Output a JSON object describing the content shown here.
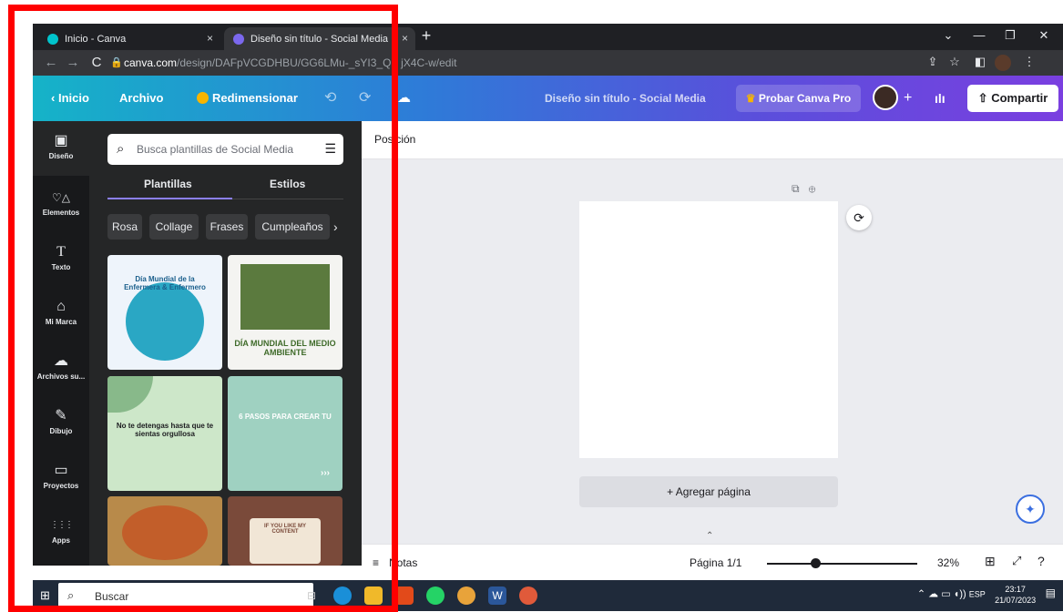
{
  "browser": {
    "tabs": [
      {
        "title": "Inicio - Canva",
        "close": "×"
      },
      {
        "title": "Diseño sin título - Social Media",
        "close": "×"
      }
    ],
    "new_tab": "+",
    "window_controls": [
      "⌄",
      "—",
      "❐",
      "✕"
    ],
    "url_host": "canva.com",
    "url_path": "/design/DAFpVCGDHBU/GG6LMu-_sYI3_QF jX4C-w/edit"
  },
  "header": {
    "back_label": "Inicio",
    "archivo": "Archivo",
    "redimensionar": "Redimensionar",
    "undo": "⟲",
    "redo": "⟳",
    "design_title": "Diseño sin título - Social Media",
    "try_pro": "Probar Canva Pro",
    "plus": "+",
    "share": "Compartir"
  },
  "sidebar": {
    "items": [
      {
        "icon": "design-icon",
        "label": "Diseño",
        "glyph": "▣"
      },
      {
        "icon": "elements-icon",
        "label": "Elementos",
        "glyph": "♡△"
      },
      {
        "icon": "text-icon",
        "label": "Texto",
        "glyph": "T"
      },
      {
        "icon": "brand-icon",
        "label": "Mi Marca",
        "glyph": "⌂"
      },
      {
        "icon": "uploads-icon",
        "label": "Archivos su...",
        "glyph": "☁"
      },
      {
        "icon": "draw-icon",
        "label": "Dibujo",
        "glyph": "✎"
      },
      {
        "icon": "folder-icon",
        "label": "Proyectos",
        "glyph": "▭"
      },
      {
        "icon": "apps-icon",
        "label": "Apps",
        "glyph": "⋮⋮⋮"
      }
    ]
  },
  "panel": {
    "search_placeholder": "Busca plantillas de Social Media",
    "tabs": [
      "Plantillas",
      "Estilos"
    ],
    "chips": [
      "Rosa",
      "Collage",
      "Frases",
      "Cumpleaños"
    ],
    "templates": [
      {
        "text": "Día Mundial de la Enfermera & Enfermero"
      },
      {
        "text": "DÍA MUNDIAL DEL MEDIO AMBIENTE"
      },
      {
        "text": "No te detengas hasta que te sientas orgullosa"
      },
      {
        "text": "6 PASOS PARA CREAR TU"
      },
      {
        "text": ""
      },
      {
        "text": "IF YOU LIKE MY CONTENT"
      }
    ]
  },
  "workspace": {
    "position_label": "Posición",
    "add_page": "+ Agregar página"
  },
  "bottom": {
    "notes": "Notas",
    "page": "Página 1/1",
    "zoom_percent": 32,
    "zoom_label": "32%"
  },
  "taskbar": {
    "search_label": "Buscar",
    "tray": "ESP",
    "time": "23:17",
    "date": "21/07/2023"
  },
  "colors": {
    "accent": "#8b7ff2",
    "annotation": "#ff0000"
  }
}
